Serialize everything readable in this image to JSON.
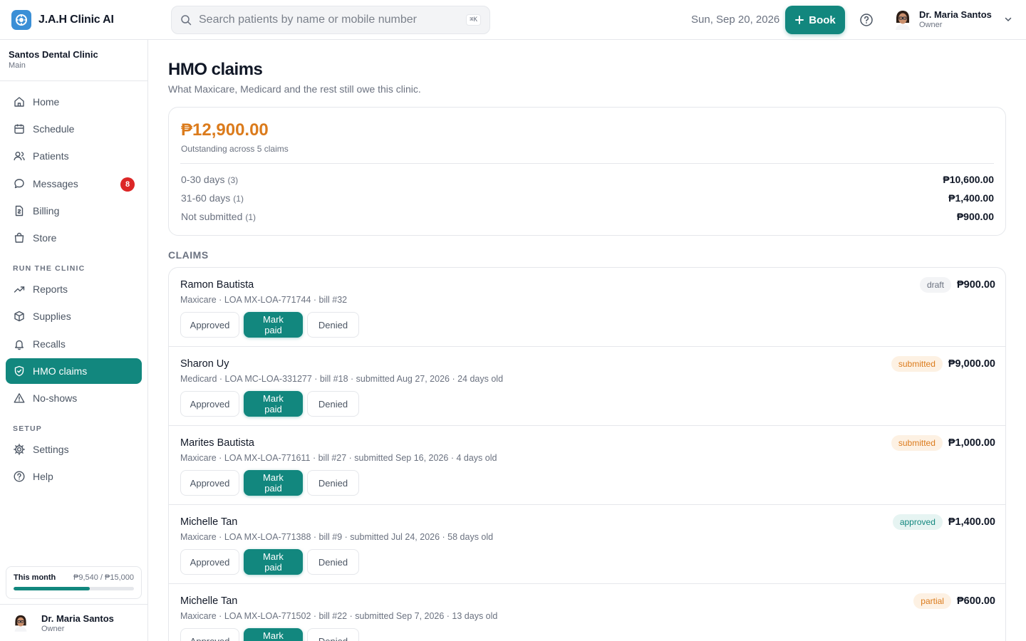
{
  "app": {
    "name": "J.A.H Clinic AI"
  },
  "search": {
    "placeholder": "Search patients by name or mobile number",
    "shortcut": "⌘K"
  },
  "header": {
    "date": "Sun, Sep 20, 2026",
    "book_label": "Book",
    "user_name": "Dr. Maria Santos",
    "user_role": "Owner"
  },
  "clinic": {
    "name": "Santos Dental Clinic",
    "branch": "Main"
  },
  "sidebar": {
    "main_items": [
      {
        "label": "Home",
        "icon": "home-icon"
      },
      {
        "label": "Schedule",
        "icon": "calendar-icon"
      },
      {
        "label": "Patients",
        "icon": "users-icon"
      },
      {
        "label": "Messages",
        "icon": "message-icon",
        "badge": "8"
      },
      {
        "label": "Billing",
        "icon": "billing-icon"
      },
      {
        "label": "Store",
        "icon": "bag-icon"
      }
    ],
    "section_run": "RUN THE CLINIC",
    "run_items": [
      {
        "label": "Reports",
        "icon": "trend-icon"
      },
      {
        "label": "Supplies",
        "icon": "box-icon"
      },
      {
        "label": "Recalls",
        "icon": "bell-icon"
      },
      {
        "label": "HMO claims",
        "icon": "shield-icon",
        "active": true
      },
      {
        "label": "No-shows",
        "icon": "warning-icon"
      }
    ],
    "section_setup": "SETUP",
    "setup_items": [
      {
        "label": "Settings",
        "icon": "gear-icon"
      },
      {
        "label": "Help",
        "icon": "help-icon"
      }
    ],
    "month": {
      "label": "This month",
      "value": "₱9,540 / ₱15,000",
      "progress": 0.636
    },
    "user_name": "Dr. Maria Santos",
    "user_role": "Owner"
  },
  "page": {
    "title": "HMO claims",
    "subtitle": "What Maxicare, Medicard and the rest still owe this clinic."
  },
  "summary": {
    "total": "₱12,900.00",
    "total_caption": "Outstanding across 5 claims",
    "buckets": [
      {
        "label": "0-30 days",
        "count": "(3)",
        "amount": "₱10,600.00"
      },
      {
        "label": "31-60 days",
        "count": "(1)",
        "amount": "₱1,400.00"
      },
      {
        "label": "Not submitted",
        "count": "(1)",
        "amount": "₱900.00"
      }
    ]
  },
  "claims_section_label": "CLAIMS",
  "claim_actions": {
    "approved": "Approved",
    "paid": "Mark paid",
    "denied": "Denied"
  },
  "claims": [
    {
      "name": "Ramon Bautista",
      "meta": "Maxicare · LOA MX-LOA-771744 · bill #32",
      "status": "draft",
      "amount": "₱900.00"
    },
    {
      "name": "Sharon Uy",
      "meta": "Medicard · LOA MC-LOA-331277 · bill #18 · submitted Aug 27, 2026 · 24 days old",
      "status": "submitted",
      "amount": "₱9,000.00"
    },
    {
      "name": "Marites Bautista",
      "meta": "Maxicare · LOA MX-LOA-771611 · bill #27 · submitted Sep 16, 2026 · 4 days old",
      "status": "submitted",
      "amount": "₱1,000.00"
    },
    {
      "name": "Michelle Tan",
      "meta": "Maxicare · LOA MX-LOA-771388 · bill #9 · submitted Jul 24, 2026 · 58 days old",
      "status": "approved",
      "amount": "₱1,400.00"
    },
    {
      "name": "Michelle Tan",
      "meta": "Maxicare · LOA MX-LOA-771502 · bill #22 · submitted Sep 7, 2026 · 13 days old",
      "status": "partial",
      "amount": "₱600.00"
    }
  ],
  "colors": {
    "accent": "#12877e",
    "amount_orange": "#db7b1c",
    "badge_red": "#dc2626",
    "logo_blue": "#3b8fd6"
  }
}
